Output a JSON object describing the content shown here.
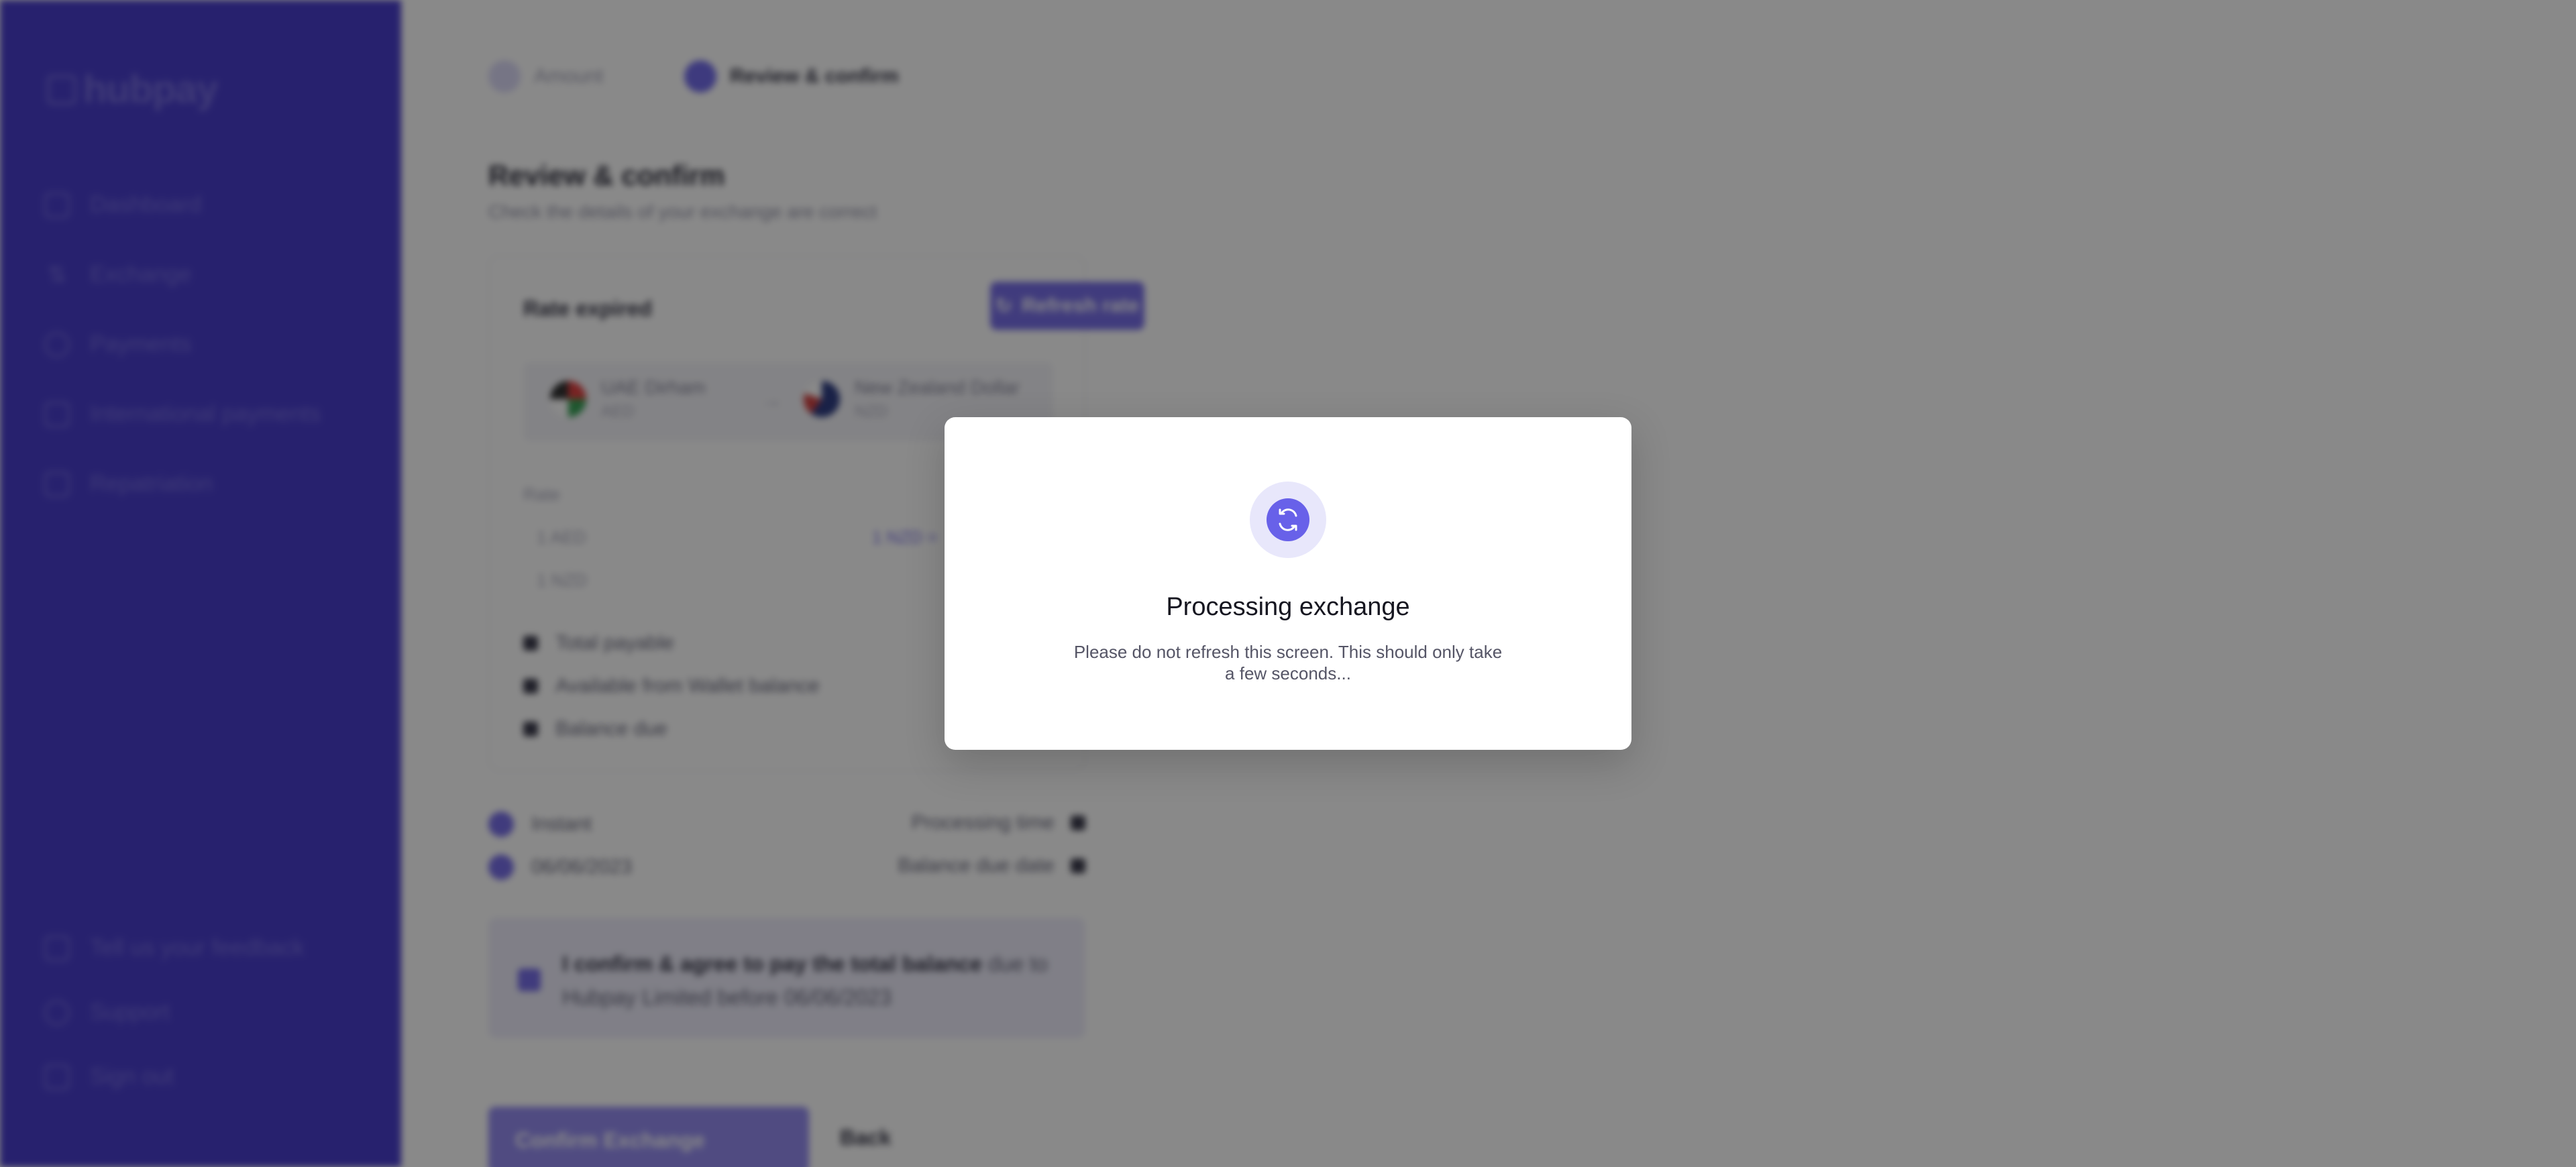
{
  "brand": {
    "name": "hubpay"
  },
  "sidebar": {
    "items": [
      {
        "label": "Dashboard",
        "icon": "dashboard-icon"
      },
      {
        "label": "Exchange",
        "icon": "exchange-icon"
      },
      {
        "label": "Payments",
        "icon": "payments-icon"
      },
      {
        "label": "International payments",
        "icon": "globe-icon"
      },
      {
        "label": "Repatriation",
        "icon": "repatriation-icon"
      }
    ],
    "footer": [
      {
        "label": "Tell us your feedback",
        "icon": "feedback-icon"
      },
      {
        "label": "Support",
        "icon": "support-icon"
      },
      {
        "label": "Sign out",
        "icon": "sign-out-icon"
      }
    ]
  },
  "stepper": {
    "steps": [
      {
        "label": "Amount",
        "state": "done"
      },
      {
        "label": "Review & confirm",
        "state": "active"
      }
    ]
  },
  "review": {
    "title": "Review & confirm",
    "subtitle": "Check the details of your exchange are correct",
    "card": {
      "title": "Rate expired",
      "refresh_label": "Refresh rate",
      "from": {
        "name": "UAE Dirham",
        "code": "AED"
      },
      "to": {
        "name": "New Zealand Dollar",
        "code": "NZD"
      },
      "rate_label": "Rate",
      "rate_lines": [
        "1 AED",
        "1 NZD"
      ],
      "rate_link": "1 NZD =",
      "summary": [
        {
          "label": "Total payable"
        },
        {
          "label": "Available from Wallet balance"
        },
        {
          "label": "Balance due"
        }
      ]
    },
    "meta": [
      {
        "left": "Instant",
        "right": "Processing time"
      },
      {
        "left": "06/06/2023",
        "right": "Balance due date"
      }
    ],
    "confirm": {
      "bold": "I confirm & agree to pay the total balance",
      "rest": " due to Hubpay Limited before 06/06/2023"
    },
    "confirm_button": "Confirm Exchange",
    "back_button": "Back"
  },
  "modal": {
    "icon": "refresh-icon",
    "title": "Processing exchange",
    "body": "Please do not refresh this screen. This should only take a few seconds..."
  },
  "colors": {
    "sidebar": "#3b2fc9",
    "accent": "#6861e9",
    "overlay": "rgba(20,20,20,0.5)"
  }
}
